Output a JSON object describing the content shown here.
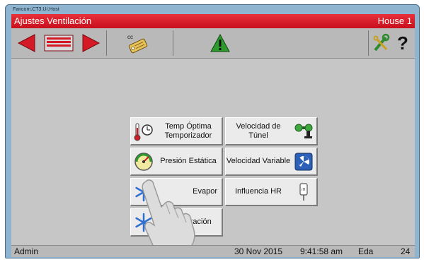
{
  "window": {
    "title": "Fancom.CT3.UI.Host"
  },
  "header": {
    "title": "Ajustes Ventilación",
    "location": "House 1"
  },
  "toolbar": {
    "nav_back_icon": "triangle-left-red",
    "list_icon": "list-red",
    "nav_forward_icon": "triangle-right-red",
    "copy_icon": "cc-tag",
    "warning_icon": "warning-triangle-green",
    "settings_icon": "wrench-key",
    "help_label": "?"
  },
  "menu": {
    "temp_optima": "Temp Óptima Temporizador",
    "velocidad_tunel": "Velocidad de Túnel",
    "presion_estatica": "Presión Estática",
    "velocidad_variable": "Velocidad Variable",
    "enfriamiento_evap": "Evapor",
    "influencia_hr": "Influencia HR",
    "refrigeracion": "Refrigeración"
  },
  "status": {
    "user": "Admin",
    "date": "30 Nov 2015",
    "time": "9:41:58 am",
    "mode": "Eda",
    "day": "24"
  },
  "colors": {
    "header": "#d41a26",
    "nav_red": "#d41a26",
    "warning_green": "#2e9a2e"
  }
}
